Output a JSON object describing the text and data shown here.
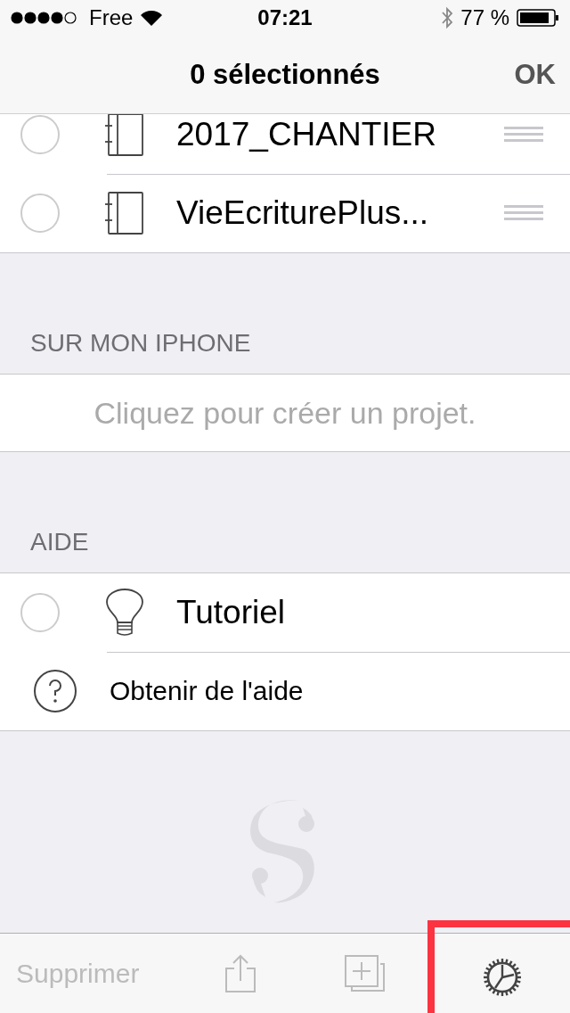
{
  "status_bar": {
    "carrier": "Free",
    "time": "07:21",
    "battery": "77 %"
  },
  "nav": {
    "title": "0 sélectionnés",
    "done": "OK"
  },
  "sections": [
    {
      "items": [
        {
          "kind": "project",
          "title": "2017_CHANTIER",
          "selected": false
        },
        {
          "kind": "project",
          "title": "VieEcriturePlus...",
          "selected": false
        }
      ]
    },
    {
      "header": "SUR MON IPHONE",
      "placeholder": "Cliquez pour créer un projet."
    },
    {
      "header": "AIDE",
      "items": [
        {
          "kind": "tutorial",
          "title": "Tutoriel",
          "selected": false
        },
        {
          "kind": "help",
          "title": "Obtenir de l'aide"
        }
      ]
    }
  ],
  "toolbar": {
    "delete": {
      "label": "Supprimer",
      "disabled": true
    },
    "settings": {
      "highlighted": true
    }
  }
}
